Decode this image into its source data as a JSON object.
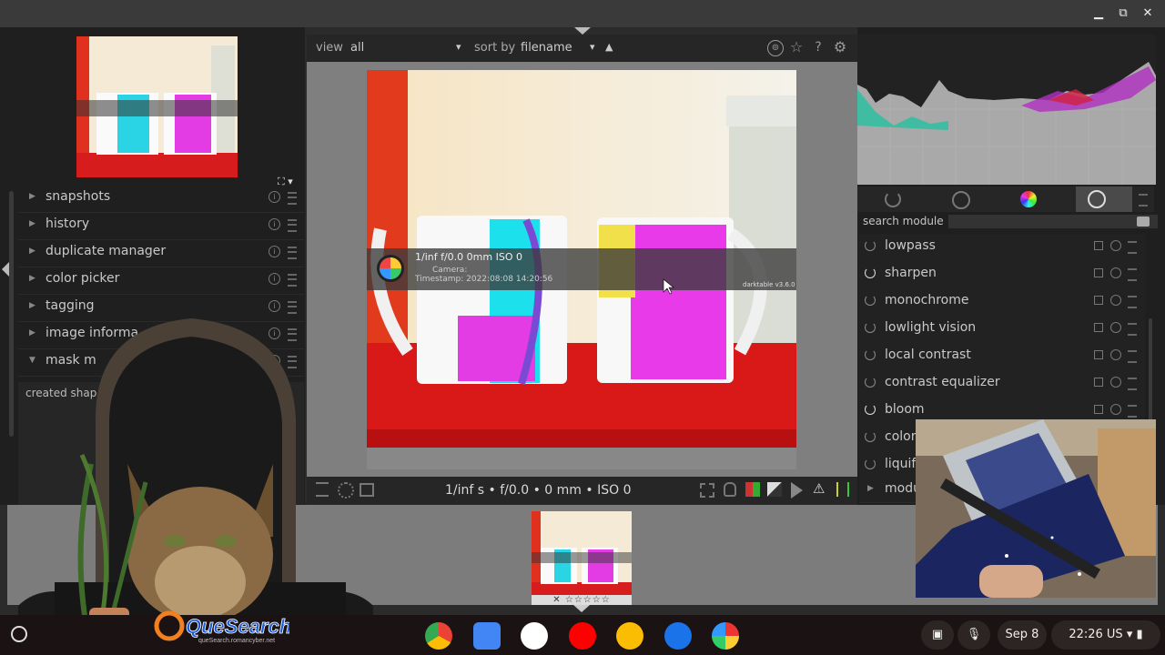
{
  "window": {
    "minimize_glyph": "▁",
    "maximize_glyph": "⧉",
    "close_glyph": "✕"
  },
  "left_panel": {
    "navigator_control": "⛶ ▾",
    "modules": [
      {
        "label": "snapshots",
        "expanded": false
      },
      {
        "label": "history",
        "expanded": false
      },
      {
        "label": "duplicate manager",
        "expanded": false
      },
      {
        "label": "color picker",
        "expanded": false
      },
      {
        "label": "tagging",
        "expanded": false
      },
      {
        "label": "image informa",
        "expanded": false
      },
      {
        "label": "mask m",
        "expanded": true
      }
    ],
    "created_shapes_label": "created shap",
    "collapsed_arrow": "▶",
    "expanded_arrow": "▼",
    "reset_glyph": "i"
  },
  "center": {
    "view_label": "view",
    "view_value": "all",
    "sort_label": "sort by",
    "sort_value": "filename",
    "sort_dir": "▲",
    "dropdown_glyph": "▾",
    "top_icons": [
      "grouping-icon",
      "star-icon",
      "help-icon",
      "gear-icon"
    ],
    "top_icon_glyphs": [
      "⊚",
      "☆",
      "?",
      "⚙"
    ],
    "image_overlay": {
      "line1": "1/inf f/0.0 0mm ISO 0",
      "line2": "Camera:",
      "line3": "Timestamp: 2022:08:08 14:20:56",
      "watermark": "darktable v3.6.0"
    },
    "exif_bar": "1/inf s • f/0.0 • 0 mm • ISO 0"
  },
  "right_panel": {
    "search_label": "search module",
    "search_value": "",
    "modules": [
      {
        "label": "lowpass",
        "on": false
      },
      {
        "label": "sharpen",
        "on": true
      },
      {
        "label": "monochrome",
        "on": false
      },
      {
        "label": "lowlight vision",
        "on": false
      },
      {
        "label": "local contrast",
        "on": false
      },
      {
        "label": "contrast equalizer",
        "on": false
      },
      {
        "label": "bloom",
        "on": true
      },
      {
        "label": "color",
        "on": false
      },
      {
        "label": "liquif",
        "on": false
      },
      {
        "label": "modu",
        "on": false,
        "collapsed": true
      }
    ]
  },
  "filmstrip": {
    "stars": "✕ ☆☆☆☆☆"
  },
  "shelf": {
    "date": "Sep 8",
    "time": "22:26",
    "locale": "US",
    "apps": [
      {
        "name": "chrome-icon",
        "color": "#dd4b39"
      },
      {
        "name": "files-icon",
        "color": "#4a8af4"
      },
      {
        "name": "gmail-icon",
        "color": "#ffffff"
      },
      {
        "name": "youtube-icon",
        "color": "#ff0000"
      },
      {
        "name": "keep-icon",
        "color": "#f9c000"
      },
      {
        "name": "messages-icon",
        "color": "#1a73e8"
      },
      {
        "name": "darktable-icon",
        "color": "#ffffff"
      }
    ]
  },
  "logo": {
    "text": "QueSearch",
    "sub": "queSearch.romancyber.net"
  }
}
